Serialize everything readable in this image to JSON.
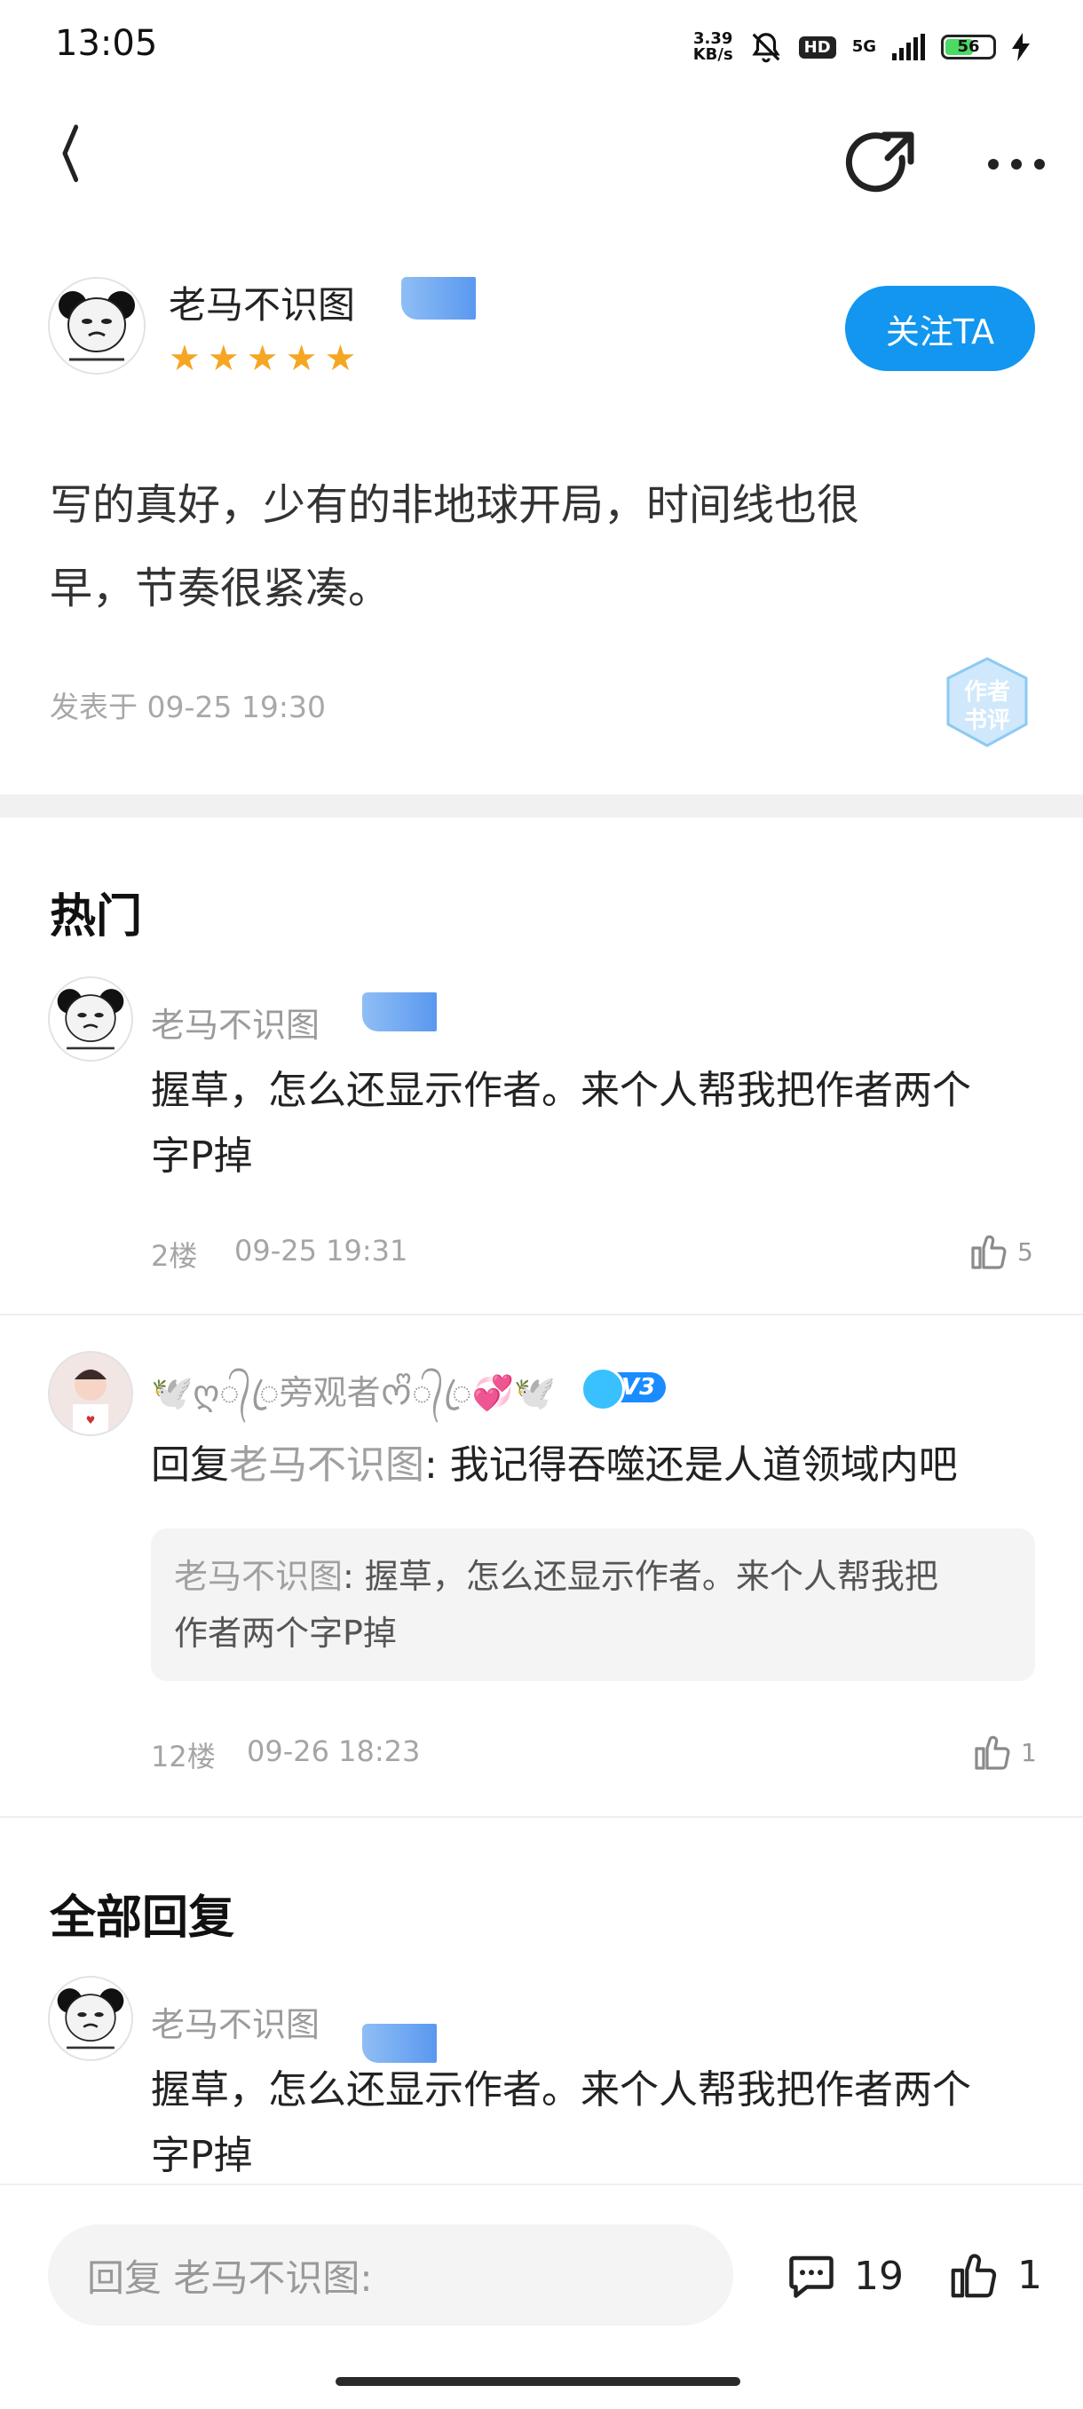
{
  "status": {
    "time": "13:05",
    "speed_top": "3.39",
    "speed_bottom": "KB/s",
    "hd": "HD",
    "network": "5G",
    "battery": "56"
  },
  "author": {
    "name": "老马不识图",
    "stars": 5
  },
  "follow_label": "关注TA",
  "post": {
    "text_line1": "写的真好，少有的非地球开局，时间线也很",
    "text_line2": "早，节奏很紧凑。",
    "time": "发表于 09-25 19:30",
    "badge_line1": "作者",
    "badge_line2": "书评"
  },
  "hot": {
    "title": "热门",
    "comments": [
      {
        "name": "老马不识图",
        "text_line1": "握草，怎么还显示作者。来个人帮我把作者两个",
        "text_line2": "字P掉",
        "floor": "2楼",
        "time": "09-25 19:31",
        "likes": "5"
      },
      {
        "name": "🕊️ღ᭄ꦿ旁观者ᰔᩚ᭄ꦿ💞🕊️",
        "level": "V3",
        "reply_prefix": "回复",
        "reply_to": "老马不识图",
        "reply_text": ": 我记得吞噬还是人道领域内吧",
        "quote_name": "老马不识图",
        "quote_text_line1": ": 握草，怎么还显示作者。来个人帮我把",
        "quote_text_line2": "作者两个字P掉",
        "floor": "12楼",
        "time": "09-26 18:23",
        "likes": "1"
      }
    ]
  },
  "all": {
    "title": "全部回复",
    "comments": [
      {
        "name": "老马不识图",
        "text_line1": "握草，怎么还显示作者。来个人帮我把作者两个",
        "text_line2": "字P掉"
      }
    ]
  },
  "bottom": {
    "reply_placeholder": "回复 老马不识图:",
    "comment_count": "19",
    "like_count": "1"
  },
  "colors": {
    "accent": "#1296f0",
    "star": "#f5a623"
  }
}
